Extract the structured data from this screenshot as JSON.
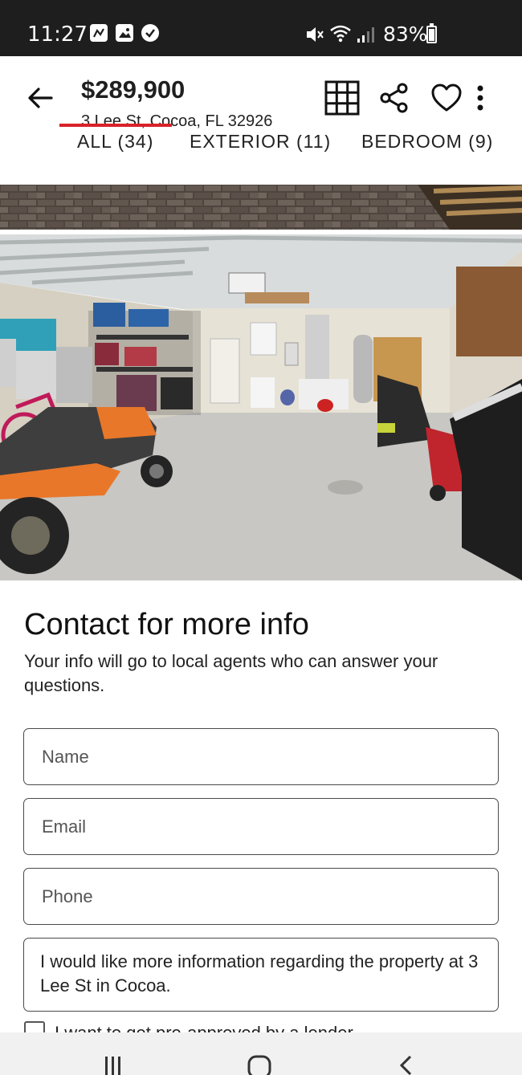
{
  "status_bar": {
    "time": "11:27",
    "battery": "83%",
    "battery_level": 0.83
  },
  "header": {
    "price": "$289,900",
    "address": "3 Lee St, Cocoa, FL 32926",
    "icons": [
      "back-arrow-icon",
      "grid-icon",
      "share-icon",
      "heart-icon",
      "more-vertical-icon"
    ]
  },
  "tabs": [
    {
      "label": "ALL (34)",
      "active": true
    },
    {
      "label": "EXTERIOR (11)",
      "active": false
    },
    {
      "label": "BEDROOM (9)",
      "active": false
    }
  ],
  "contact": {
    "title": "Contact for more info",
    "subtitle": "Your info will go to local agents who can answer your questions.",
    "name_placeholder": "Name",
    "email_placeholder": "Email",
    "phone_placeholder": "Phone",
    "message": "I would like more information regarding the property at 3 Lee St in Cocoa.",
    "checkbox_label": "I want to get pre-approved by a lender"
  },
  "colors": {
    "accent": "#d92228",
    "status_bar": "#1e1e1e"
  }
}
